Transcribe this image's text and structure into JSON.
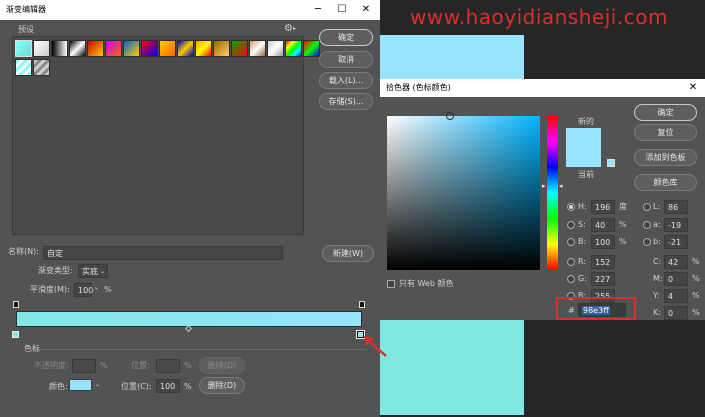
{
  "watermark": "www.haoyidiansheji.com",
  "gradient_editor": {
    "title": "渐变编辑器",
    "presets_label": "预设",
    "buttons": {
      "ok": "确定",
      "cancel": "取消",
      "load": "载入(L)...",
      "save": "存储(S)...",
      "new": "新建(W)"
    },
    "name_label": "名称(N):",
    "name_value": "自定",
    "gradient_type_label": "渐变类型:",
    "gradient_type_value": "实底",
    "smoothness_label": "平滑度(M):",
    "smoothness_value": "100",
    "percent": "%",
    "stops_section": "色标",
    "opacity_label": "不透明度:",
    "location_label": "位置:",
    "delete_label": "删除(D)",
    "color_label": "颜色:",
    "color_location_label": "位置(C):",
    "color_location_value": "100",
    "color_delete_label": "删除(D)",
    "gradient_colors": [
      "#7fe8e3",
      "#98e3ff"
    ]
  },
  "color_picker": {
    "title": "拾色器 (色标颜色)",
    "new_label": "新的",
    "current_label": "当前",
    "new_color": "#98e3ff",
    "current_color": "#98e3ff",
    "buttons": {
      "ok": "确定",
      "reset": "复位",
      "add_swatch": "添加到色板",
      "color_libraries": "颜色库"
    },
    "web_only_label": "只有 Web 颜色",
    "fields": {
      "H": {
        "label": "H:",
        "value": "196",
        "unit": "度"
      },
      "S": {
        "label": "S:",
        "value": "40",
        "unit": "%"
      },
      "B": {
        "label": "B:",
        "value": "100",
        "unit": "%"
      },
      "R": {
        "label": "R:",
        "value": "152"
      },
      "G": {
        "label": "G:",
        "value": "227"
      },
      "Bb": {
        "label": "B:",
        "value": "255"
      },
      "L": {
        "label": "L:",
        "value": "86"
      },
      "a": {
        "label": "a:",
        "value": "-19"
      },
      "b": {
        "label": "b:",
        "value": "-21"
      },
      "C": {
        "label": "C:",
        "value": "42",
        "unit": "%"
      },
      "M": {
        "label": "M:",
        "value": "0",
        "unit": "%"
      },
      "Y": {
        "label": "Y:",
        "value": "4",
        "unit": "%"
      },
      "K": {
        "label": "K:",
        "value": "0",
        "unit": "%"
      }
    },
    "hex_label": "#",
    "hex_value": "98e3ff",
    "hue_level": 0.46
  },
  "background_colors": {
    "canvas_top": "#98e3ff",
    "canvas_bottom": "#7fe8e3"
  },
  "accent_red": "#d9302a"
}
